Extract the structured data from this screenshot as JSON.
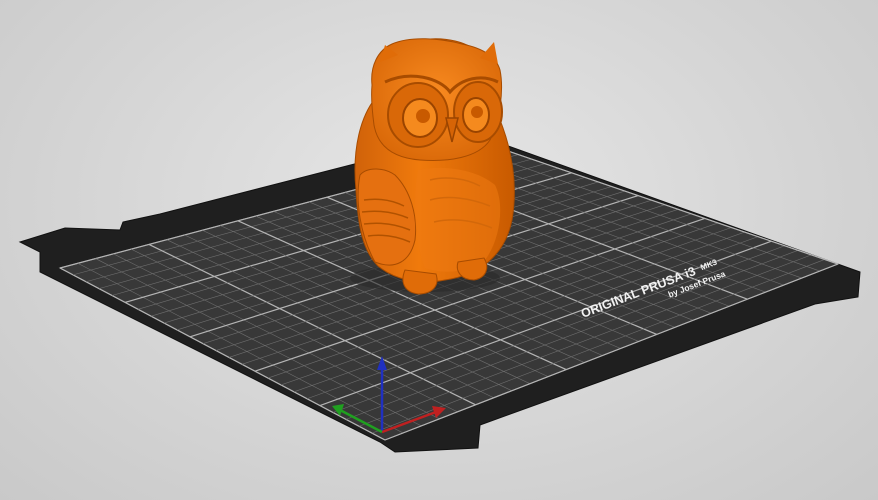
{
  "app": "PrusaSlicer 3D view",
  "bed": {
    "brand_line": "ORIGINAL PRUSA i3",
    "model_suffix": "MK3",
    "maker_line": "by Josef Prusa",
    "sheet_color": "#3a3a3a",
    "frame_color": "#1f1f1f",
    "grid_color": "#8a8a8a"
  },
  "model": {
    "name": "owl",
    "color": "#f07a0c",
    "shade_color": "#c45a00",
    "highlight_color": "#ff9a3a"
  },
  "axes": {
    "x_color": "#c02020",
    "y_color": "#20a020",
    "z_color": "#2030c0"
  }
}
